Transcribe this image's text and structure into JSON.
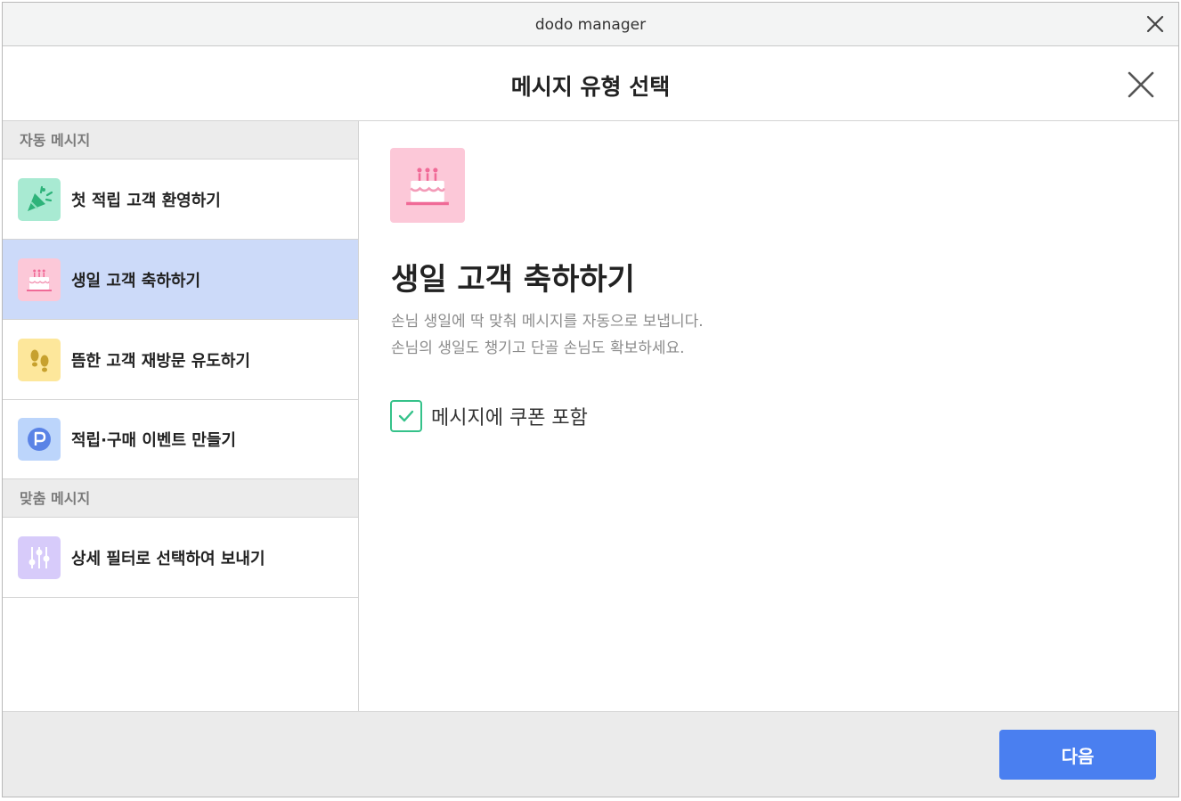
{
  "window": {
    "title": "dodo manager"
  },
  "modal": {
    "title": "메시지 유형 선택"
  },
  "sidebar": {
    "auto_section": "자동 메시지",
    "auto_items": [
      {
        "label": "첫 적립 고객 환영하기",
        "icon": "party-popper-icon",
        "color": "#a8ead2"
      },
      {
        "label": "생일 고객 축하하기",
        "icon": "birthday-cake-icon",
        "color": "#fcc8d8",
        "selected": true
      },
      {
        "label": "뜸한 고객 재방문 유도하기",
        "icon": "footprints-icon",
        "color": "#fde79b"
      },
      {
        "label": "적립·구매 이벤트 만들기",
        "icon": "points-icon",
        "color": "#bcd5fb"
      }
    ],
    "custom_section": "맞춤 메시지",
    "custom_items": [
      {
        "label": "상세 필터로 선택하여 보내기",
        "icon": "filter-sliders-icon",
        "color": "#d7cbfa"
      }
    ]
  },
  "detail": {
    "title": "생일 고객 축하하기",
    "description_line1": "손님 생일에 딱 맞춰 메시지를 자동으로 보냅니다.",
    "description_line2": "손님의 생일도 챙기고 단골 손님도 확보하세요.",
    "coupon_label": "메시지에 쿠폰 포함",
    "coupon_checked": true
  },
  "footer": {
    "next_label": "다음"
  },
  "colors": {
    "accent": "#4a7ff0",
    "selected_bg": "#ccdaf9",
    "check": "#35c28a"
  }
}
